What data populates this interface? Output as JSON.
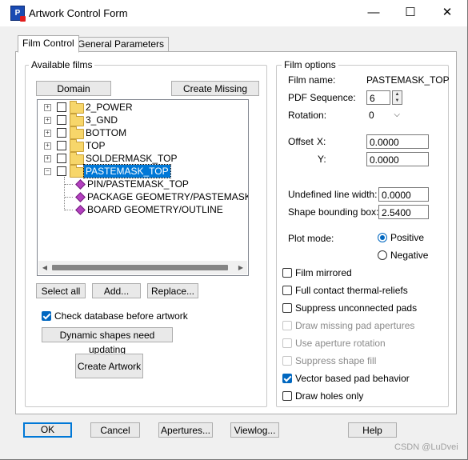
{
  "window": {
    "title": "Artwork Control Form"
  },
  "titlebar": {
    "minimize": "—",
    "maximize": "☐",
    "close": "✕"
  },
  "tabs": [
    {
      "label": "Film Control"
    },
    {
      "label": "General Parameters"
    }
  ],
  "available_films": {
    "label": "Available films",
    "domain_selection": "Domain Selection",
    "create_missing_films": "Create Missing Films",
    "tree": [
      {
        "label": "2_POWER",
        "expanded": false,
        "selected": false
      },
      {
        "label": "3_GND",
        "expanded": false,
        "selected": false
      },
      {
        "label": "BOTTOM",
        "expanded": false,
        "selected": false
      },
      {
        "label": "TOP",
        "expanded": false,
        "selected": false
      },
      {
        "label": "SOLDERMASK_TOP",
        "expanded": false,
        "selected": false
      },
      {
        "label": "PASTEMASK_TOP",
        "expanded": true,
        "selected": true
      }
    ],
    "subclasses": [
      {
        "label": "PIN/PASTEMASK_TOP"
      },
      {
        "label": "PACKAGE GEOMETRY/PASTEMASK_TOP"
      },
      {
        "label": "BOARD GEOMETRY/OUTLINE"
      }
    ],
    "select_all": "Select all",
    "add": "Add...",
    "replace": "Replace..."
  },
  "check_database": {
    "label": "Check database before artwork",
    "checked": true
  },
  "dynamic_shapes": "Dynamic shapes need updating",
  "create_artwork": "Create Artwork",
  "film_options": {
    "label": "Film options",
    "film_name_label": "Film name:",
    "film_name": "PASTEMASK_TOP",
    "pdf_sequence_label": "PDF Sequence:",
    "pdf_sequence": "6",
    "rotation_label": "Rotation:",
    "rotation": "0",
    "offset_label": "Offset",
    "offset_x_label": "X:",
    "offset_x": "0.0000",
    "offset_y_label": "Y:",
    "offset_y": "0.0000",
    "undefined_line_width_label": "Undefined line width:",
    "undefined_line_width": "0.0000",
    "shape_bounding_box_label": "Shape bounding box:",
    "shape_bounding_box": "2.5400",
    "plot_mode_label": "Plot mode:",
    "plot_mode_positive": "Positive",
    "plot_mode_negative": "Negative",
    "plot_mode_selected": "Positive",
    "checkboxes": [
      {
        "label": "Film mirrored",
        "checked": false,
        "enabled": true
      },
      {
        "label": "Full contact thermal-reliefs",
        "checked": false,
        "enabled": true
      },
      {
        "label": "Suppress unconnected pads",
        "checked": false,
        "enabled": true
      },
      {
        "label": "Draw missing pad apertures",
        "checked": false,
        "enabled": false
      },
      {
        "label": "Use aperture rotation",
        "checked": false,
        "enabled": false
      },
      {
        "label": "Suppress shape fill",
        "checked": false,
        "enabled": false
      },
      {
        "label": "Vector based pad behavior",
        "checked": true,
        "enabled": true
      },
      {
        "label": "Draw holes only",
        "checked": false,
        "enabled": true
      }
    ]
  },
  "footer": {
    "ok": "OK",
    "cancel": "Cancel",
    "apertures": "Apertures...",
    "viewlog": "Viewlog...",
    "help": "Help"
  },
  "watermark": "CSDN @LuDvei",
  "colors": {
    "accent": "#0078d7",
    "selection": "#0078d7",
    "background_stripe": "#9b1fa0"
  }
}
